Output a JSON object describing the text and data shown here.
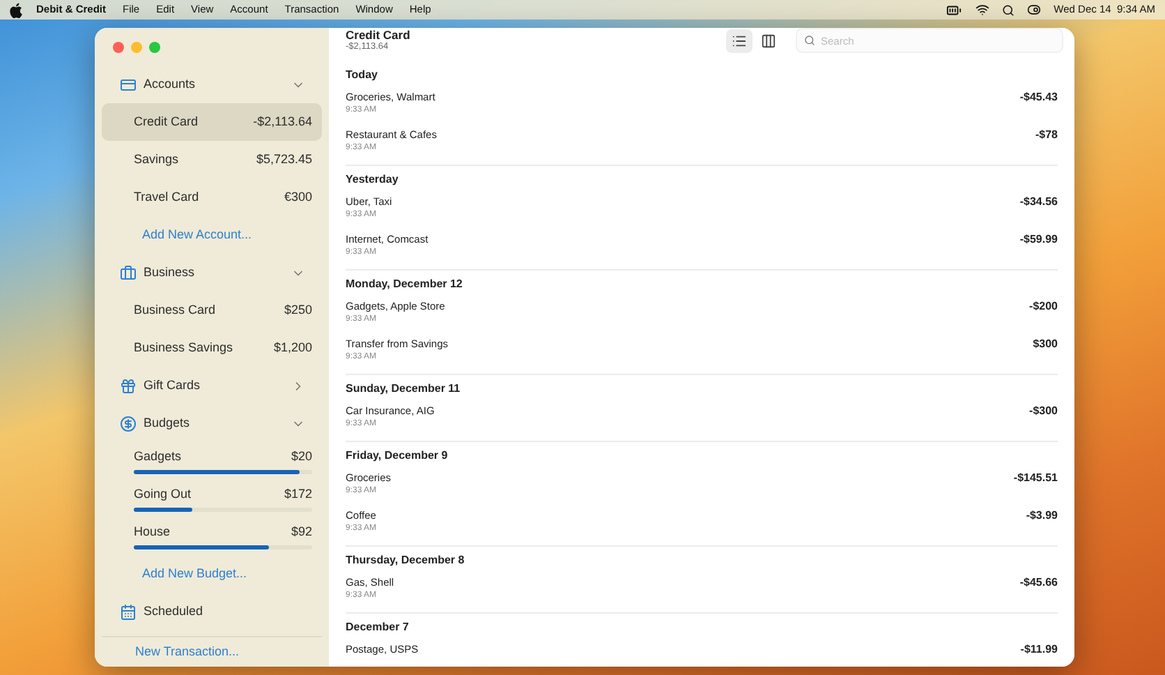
{
  "menubar": {
    "app_name": "Debit & Credit",
    "menus": [
      "File",
      "Edit",
      "View",
      "Account",
      "Transaction",
      "Window",
      "Help"
    ],
    "clock": "Wed Dec 14  9:34 AM"
  },
  "sidebar": {
    "sections": [
      {
        "label": "Accounts",
        "expanded": true,
        "items": [
          {
            "kind": "account",
            "name": "Credit Card",
            "amount": "-$2,113.64",
            "selected": true
          },
          {
            "kind": "account",
            "name": "Savings",
            "amount": "$5,723.45",
            "selected": false
          },
          {
            "kind": "account",
            "name": "Travel Card",
            "amount": "€300",
            "selected": false
          }
        ],
        "add_link": "Add New Account..."
      },
      {
        "label": "Business",
        "expanded": true,
        "items": [
          {
            "kind": "account",
            "name": "Business Card",
            "amount": "$250",
            "selected": false
          },
          {
            "kind": "account",
            "name": "Business Savings",
            "amount": "$1,200",
            "selected": false
          }
        ]
      },
      {
        "label": "Gift Cards",
        "expanded": false
      },
      {
        "label": "Budgets",
        "expanded": true,
        "items": [
          {
            "kind": "budget",
            "name": "Gadgets",
            "amount": "$20",
            "level": 0.93
          },
          {
            "kind": "budget",
            "name": "Going Out",
            "amount": "$172",
            "level": 0.33
          },
          {
            "kind": "budget",
            "name": "House",
            "amount": "$92",
            "level": 0.76
          }
        ],
        "add_link": "Add New Budget..."
      },
      {
        "label": "Scheduled"
      }
    ],
    "new_transaction": "New Transaction..."
  },
  "header": {
    "title": "Credit Card",
    "balance": "-$2,113.64",
    "view_buttons": [
      {
        "selected": true
      },
      {
        "selected": false
      }
    ],
    "search": {
      "placeholder": "Search"
    }
  },
  "groups": [
    {
      "date": "Today",
      "transactions": [
        {
          "name": "Groceries, Walmart",
          "time": "9:33 AM",
          "amount": "-$45.43"
        },
        {
          "name": "Restaurant & Cafes",
          "time": "9:33 AM",
          "amount": "-$78"
        }
      ]
    },
    {
      "date": "Yesterday",
      "transactions": [
        {
          "name": "Uber, Taxi",
          "time": "9:33 AM",
          "amount": "-$34.56"
        },
        {
          "name": "Internet, Comcast",
          "time": "9:33 AM",
          "amount": "-$59.99"
        }
      ]
    },
    {
      "date": "Monday, December 12",
      "transactions": [
        {
          "name": "Gadgets, Apple Store",
          "time": "9:33 AM",
          "amount": "-$200"
        },
        {
          "name": "Transfer from Savings",
          "time": "9:33 AM",
          "amount": "$300"
        }
      ]
    },
    {
      "date": "Sunday, December 11",
      "transactions": [
        {
          "name": "Car Insurance, AIG",
          "time": "9:33 AM",
          "amount": "-$300"
        }
      ]
    },
    {
      "date": "Friday, December 9",
      "transactions": [
        {
          "name": "Groceries",
          "time": "9:33 AM",
          "amount": "-$145.51"
        },
        {
          "name": "Coffee",
          "time": "9:33 AM",
          "amount": "-$3.99"
        }
      ]
    },
    {
      "date": "Thursday, December 8",
      "transactions": [
        {
          "name": "Gas, Shell",
          "time": "9:33 AM",
          "amount": "-$45.66"
        }
      ]
    },
    {
      "date": "December 7",
      "transactions": [
        {
          "name": "Postage, USPS",
          "amount": "-$11.99"
        }
      ]
    }
  ]
}
